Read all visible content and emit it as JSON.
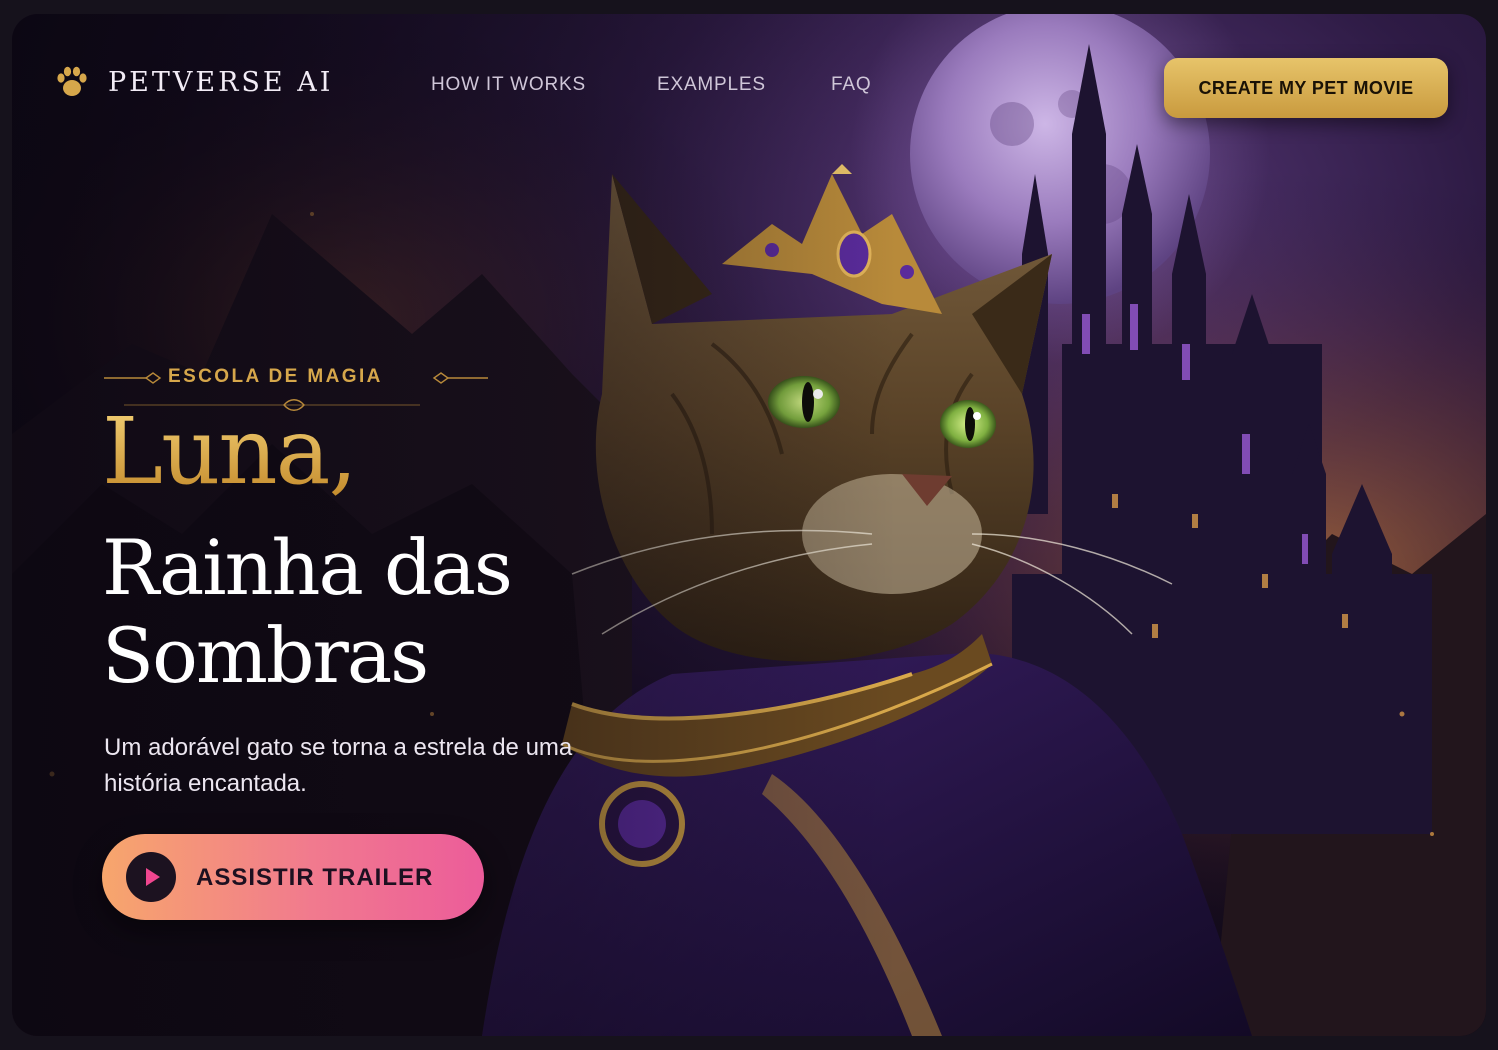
{
  "brand": {
    "name": "PETVERSE AI",
    "icon": "paw-icon",
    "accent": "#d6a74b"
  },
  "nav": {
    "links": [
      "HOW IT WORKS",
      "EXAMPLES",
      "FAQ"
    ],
    "cta_label": "CREATE MY PET MOVIE"
  },
  "hero": {
    "eyebrow": "ESCOLA DE MAGIA",
    "title_name": "Luna,",
    "title_line1": "Rainha das",
    "title_line2": "Sombras",
    "subtitle": "Um adorável gato se torna a estrela de uma história encantada.",
    "cta_label": "ASSISTIR TRAILER",
    "cta_icon": "play-icon"
  },
  "colors": {
    "gold": "#e0b04c",
    "background": "#120b1c",
    "trailer_gradient_start": "#f7a66c",
    "trailer_gradient_end": "#ec5c9a"
  }
}
